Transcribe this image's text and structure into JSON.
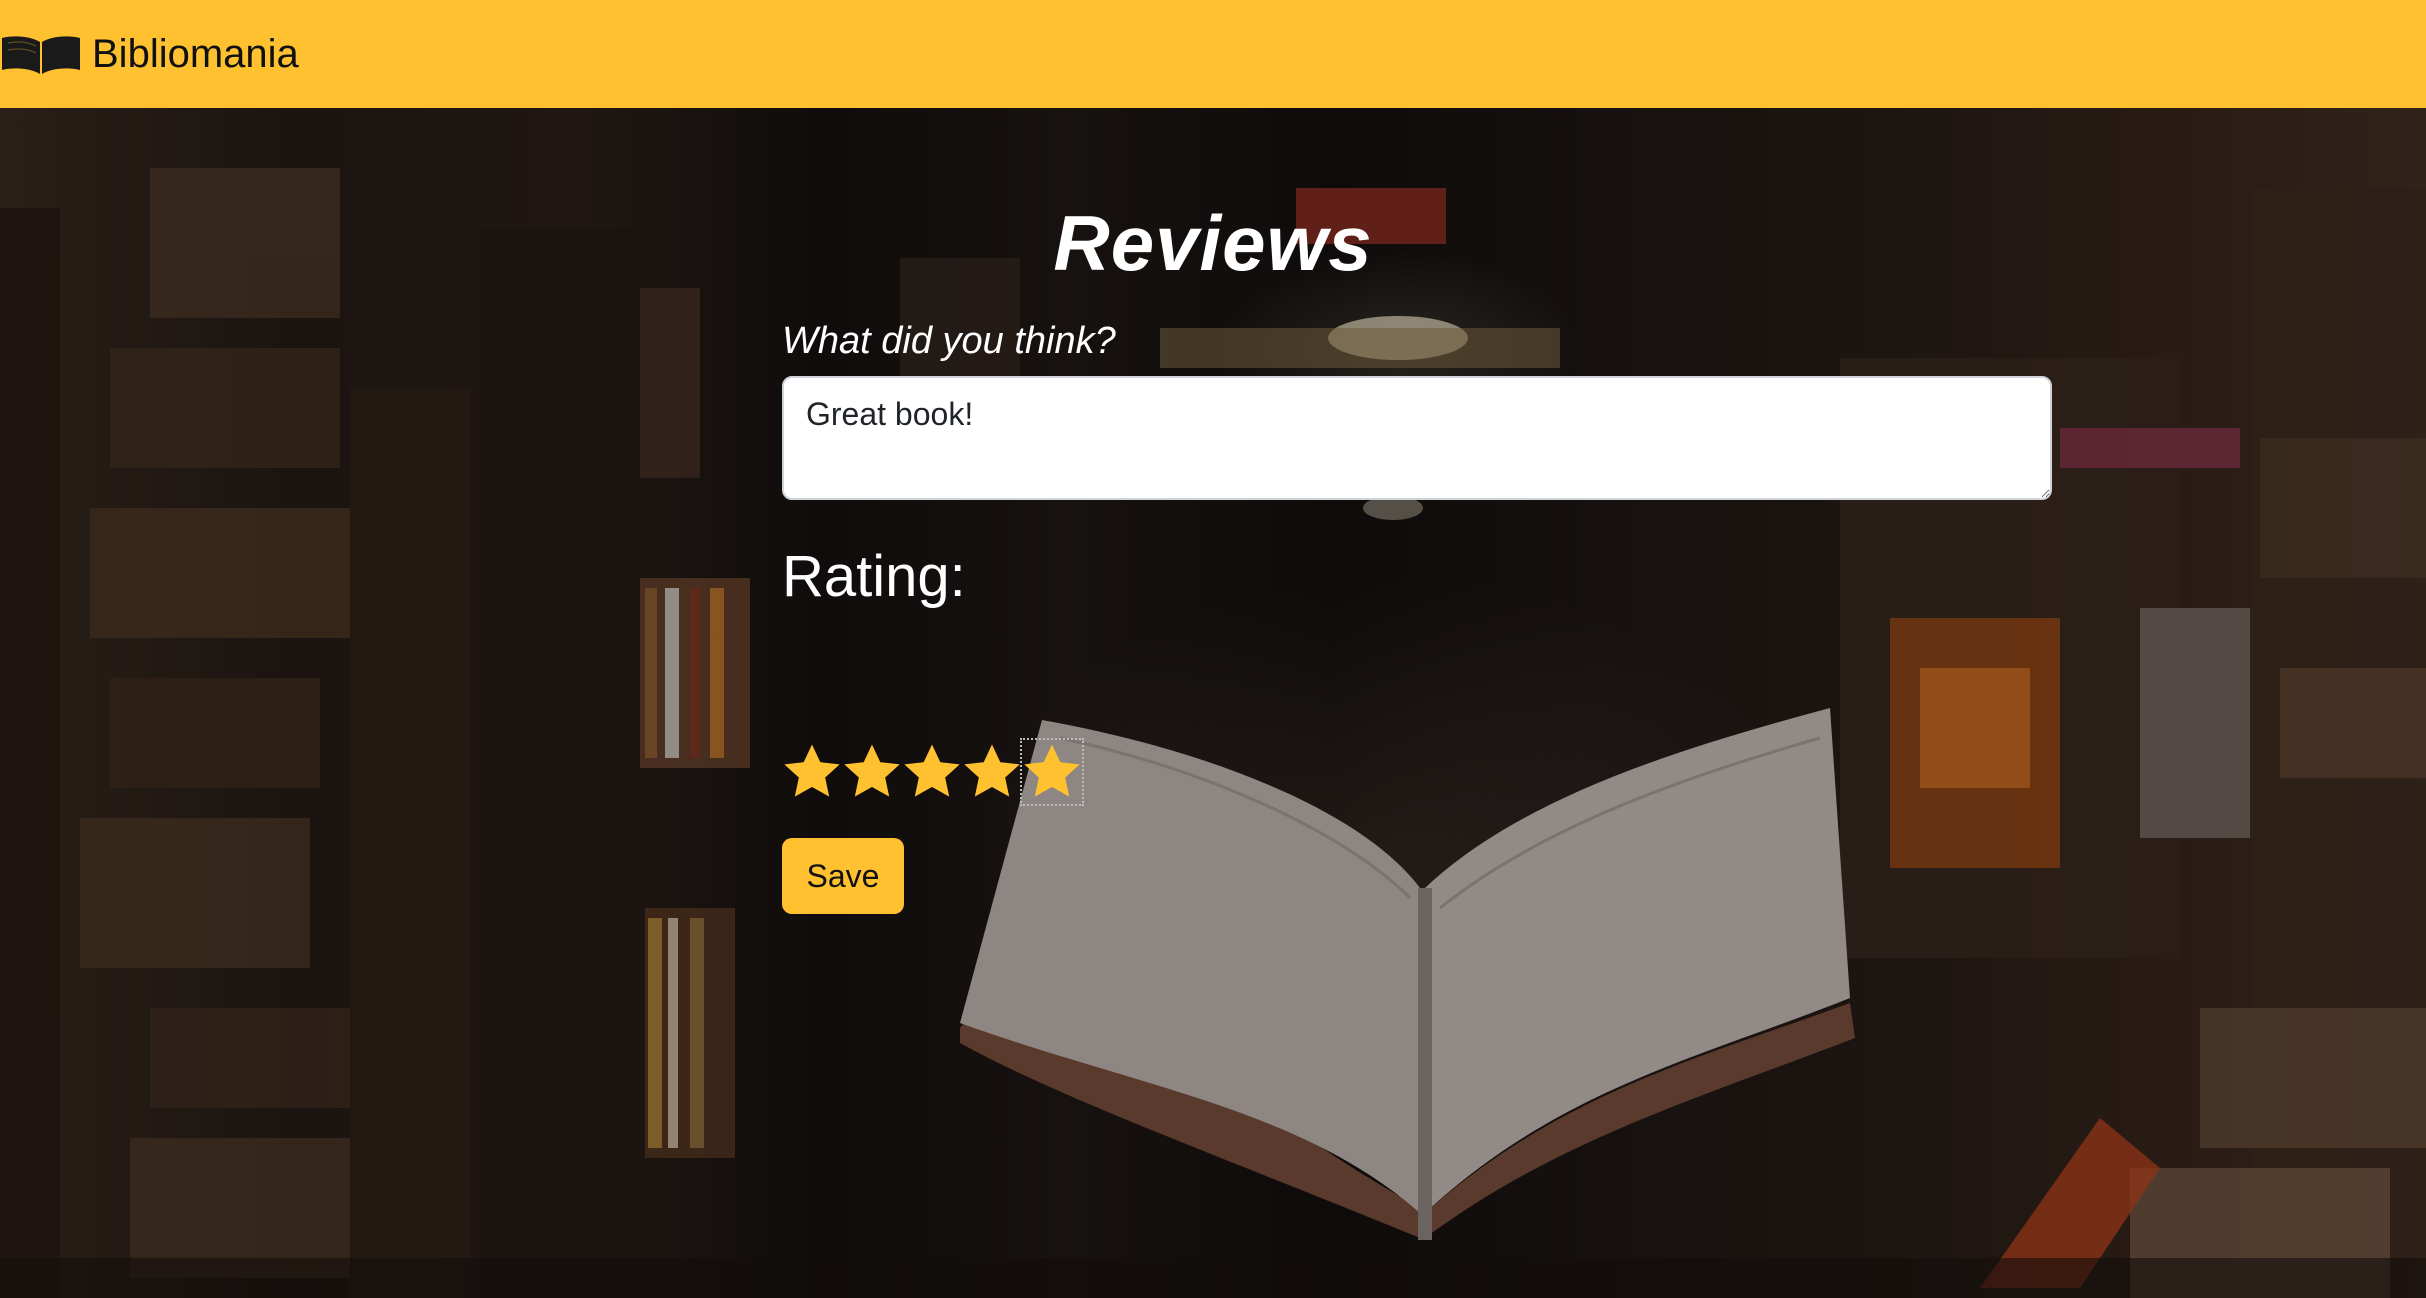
{
  "navbar": {
    "brand_name": "Bibliomania",
    "brand_icon": "open-book-icon",
    "background_color": "#ffc12f"
  },
  "hero": {
    "background": "dim photo of bookshelves in a library with an open book"
  },
  "reviews": {
    "title": "Reviews",
    "prompt_label": "What did you think?",
    "review_text": "Great book!",
    "rating_label": "Rating:",
    "rating": 5,
    "max_rating": 5,
    "star_color": "#ffc12f",
    "save_label": "Save"
  }
}
